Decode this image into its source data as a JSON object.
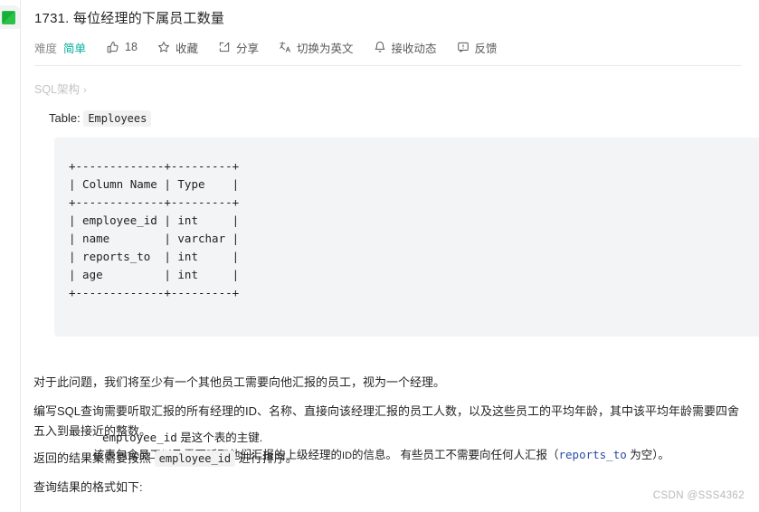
{
  "browser": {
    "favicon_name": "leetcode-green-tab-favicon"
  },
  "problem": {
    "title": "1731. 每位经理的下属员工数量",
    "difficulty_label": "难度",
    "difficulty_value": "简单",
    "difficulty_color": "#00af9b"
  },
  "toolbar": {
    "like_count": "18",
    "favorite_label": "收藏",
    "share_label": "分享",
    "translate_label": "切换为英文",
    "subscribe_label": "接收动态",
    "feedback_label": "反馈"
  },
  "schema": {
    "link_label": "SQL架构",
    "chevron": "›",
    "table_label": "Table:",
    "table_name": "Employees",
    "ascii_table": "+-------------+---------+\n| Column Name | Type    |\n+-------------+---------+\n| employee_id | int     |\n| name        | varchar |\n| reports_to  | int     |\n| age         | int     |\n+-------------+---------+",
    "note_pk_code": "employee_id",
    "note_pk_text": " 是这个表的主键.",
    "note_desc_1": "该表包含员工以及需要听取他们汇报的上级经理的",
    "note_desc_id": "ID",
    "note_desc_2": "的信息。  有些员工不需要向任何人汇报（",
    "note_desc_code": "reports_to",
    "note_desc_3": " 为空）。"
  },
  "body": {
    "paragraph_1": "对于此问题，我们将至少有一个其他员工需要向他汇报的员工，视为一个经理。",
    "paragraph_2": "编写SQL查询需要听取汇报的所有经理的ID、名称、直接向该经理汇报的员工人数，以及这些员工的平均年龄，其中该平均年龄需要四舍五入到最接近的整数。",
    "paragraph_3_pre": "返回的结果集需要按照",
    "paragraph_3_code": "employee_id",
    "paragraph_3_post": "进行排序。",
    "paragraph_4": "查询结果的格式如下:"
  },
  "watermark": {
    "text": "CSDN @SSS4362"
  }
}
